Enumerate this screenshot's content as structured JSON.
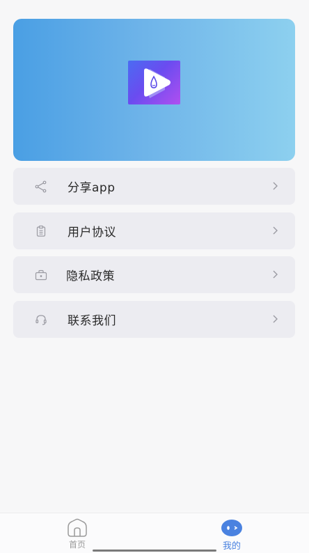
{
  "banner": {
    "logo_icon": "video-play-water-drop-icon"
  },
  "menu": {
    "items": [
      {
        "label": "分享app",
        "icon": "share-icon"
      },
      {
        "label": "用户协议",
        "icon": "clipboard-icon"
      },
      {
        "label": "隐私政策",
        "icon": "briefcase-lock-icon"
      },
      {
        "label": "联系我们",
        "icon": "headset-icon"
      }
    ],
    "arrow_icon": "chevron-right-icon"
  },
  "tabbar": {
    "tabs": [
      {
        "label": "首页",
        "icon": "home-icon",
        "active": false
      },
      {
        "label": "我的",
        "icon": "mine-face-icon",
        "active": true
      }
    ]
  },
  "colors": {
    "active_tab": "#4a82e0",
    "banner_start": "#4a9fe4",
    "banner_end": "#8dd0ef",
    "menu_bg": "#ececf1"
  }
}
